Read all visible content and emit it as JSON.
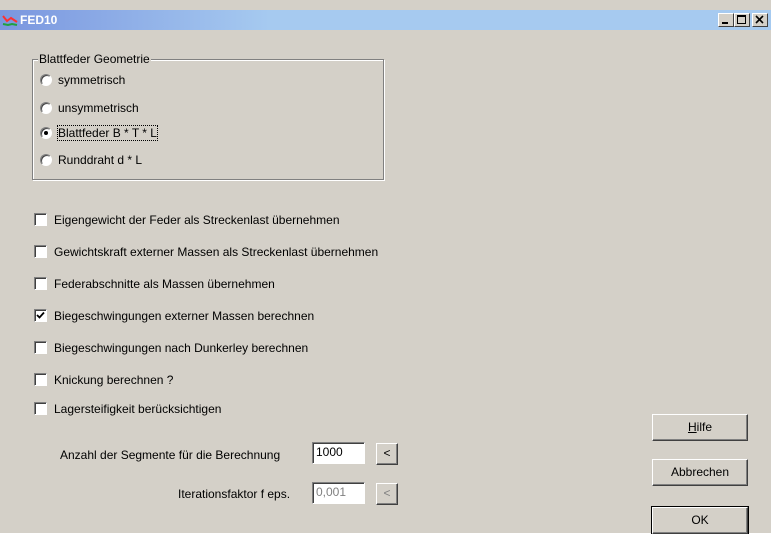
{
  "window": {
    "title": "FED10",
    "controls": {
      "minimize": "_",
      "maximize": "□",
      "close": "×"
    }
  },
  "geometry_group": {
    "label": "Blattfeder Geometrie",
    "options": [
      {
        "label": "symmetrisch",
        "selected": false
      },
      {
        "label": "unsymmetrisch",
        "selected": false
      },
      {
        "label": "Blattfeder B * T * L",
        "selected": true
      },
      {
        "label": "Runddraht d * L",
        "selected": false
      }
    ]
  },
  "checkboxes": [
    {
      "label": "Eigengewicht der Feder als Streckenlast übernehmen",
      "checked": false
    },
    {
      "label": "Gewichtskraft externer Massen als Streckenlast übernehmen",
      "checked": false
    },
    {
      "label": "Federabschnitte als Massen übernehmen",
      "checked": false
    },
    {
      "label": "Biegeschwingungen externer Massen berechnen",
      "checked": true
    },
    {
      "label": "Biegeschwingungen nach Dunkerley berechnen",
      "checked": false
    },
    {
      "label": "Knickung berechnen ?",
      "checked": false
    },
    {
      "label": "Lagersteifigkeit berücksichtigen",
      "checked": false
    }
  ],
  "segments": {
    "label": "Anzahl der Segmente für die Berechnung",
    "value": "1000",
    "button": "<"
  },
  "iteration": {
    "label": "Iterationsfaktor f eps.",
    "value": "0,001",
    "button": "<"
  },
  "buttons": {
    "help_first": "H",
    "help_rest": "ilfe",
    "cancel": "Abbrechen",
    "ok": "OK"
  },
  "colors": {
    "face": "#d4d0c8",
    "title_start": "#7a96df",
    "title_end": "#a6caf0"
  }
}
